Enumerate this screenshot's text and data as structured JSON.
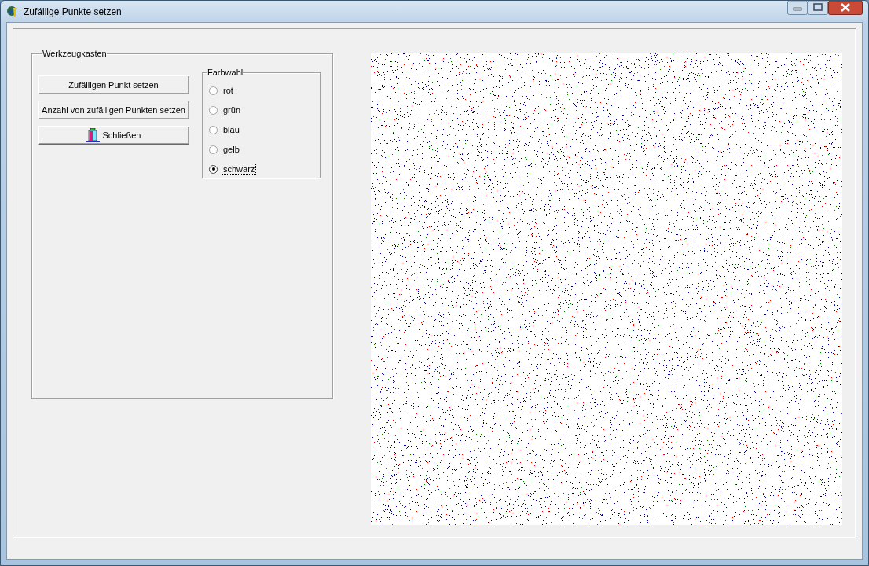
{
  "window": {
    "title": "Zufällige Punkte setzen"
  },
  "toolbox": {
    "title": "Werkzeugkasten",
    "buttons": [
      {
        "label": "Zufälligen Punkt setzen",
        "kind": "plain"
      },
      {
        "label": "Anzahl von zufälligen Punkten setzen",
        "kind": "plain"
      },
      {
        "label": "Schließen",
        "kind": "close"
      }
    ],
    "color_choice": {
      "title": "Farbwahl",
      "options": [
        {
          "label": "rot",
          "selected": false
        },
        {
          "label": "grün",
          "selected": false
        },
        {
          "label": "blau",
          "selected": false
        },
        {
          "label": "gelb",
          "selected": false
        },
        {
          "label": "schwarz",
          "selected": true
        }
      ]
    }
  }
}
